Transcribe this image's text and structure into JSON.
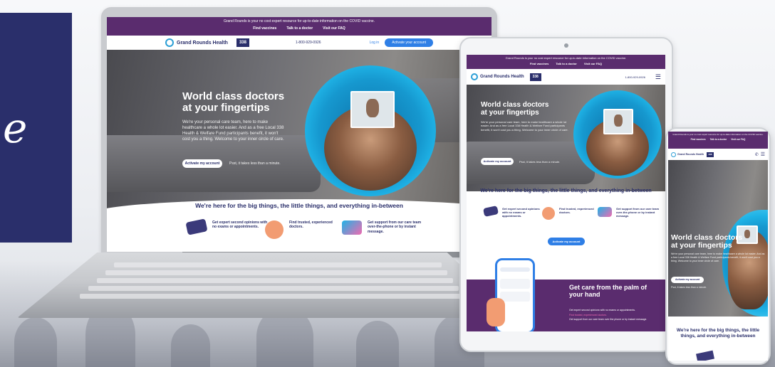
{
  "brand_glyph": "e",
  "site": {
    "banner": "Grand Rounds is your no cost expert resource for up-to-date information on the COVID vaccine.",
    "banner_short": "Grand Rounds is your no cost expert resource for up-to-date information on the COVID vaccine.",
    "banner_links": [
      "Find vaccines",
      "Talk to a doctor",
      "Visit our FAQ"
    ],
    "logo": "Grand Rounds Health",
    "partner_badge": "338",
    "phone": "1-800-929-0926",
    "login": "Log in",
    "activate_nav": "Activate your account",
    "hero_title_line1": "World class doctors",
    "hero_title_line2": "at your fingertips",
    "hero_copy": "We're your personal care team, here to make healthcare a whole lot easier. And as a free Local 338 Health & Welfare Fund participants benefit, it won't cost you a thing. Welcome to your inner circle of care.",
    "hero_copy_tablet": "We're your personal care team, here to make healthcare a whole lot easier. And as a free Local 338 Health & Welfare Fund participants benefit, it won't cost you a thing. Welcome to your inner circle of care.",
    "hero_copy_phone": "We're your personal care team, here to make healthcare a whole lot easier. And as a free Local 338 Health & Welfare Fund participants benefit, it won't cost you a thing. Welcome to your inner circle of care.",
    "activate_btn": "Activate my account",
    "psst": "Psst, it takes less than a minute.",
    "section_title": "We're here for the big things, the little things, and everything in-between",
    "features": [
      "Get expert second opinions with no exams or appointments.",
      "Find trusted, experienced doctors.",
      "Get support from our care team over-the-phone or by instant message."
    ],
    "activate_btn2": "Activate my account",
    "palm_title": "Get care from the palm of your hand",
    "palm_items": [
      "Get expert second opinions with no exams or appointments.",
      "Find trusted, experienced doctors.",
      "Get support from our care team over the phone or by instant message."
    ]
  },
  "colors": {
    "banner": "#5a2c6e",
    "brand_navy": "#2a2f6b",
    "accent_blue": "#2f7fe6"
  }
}
